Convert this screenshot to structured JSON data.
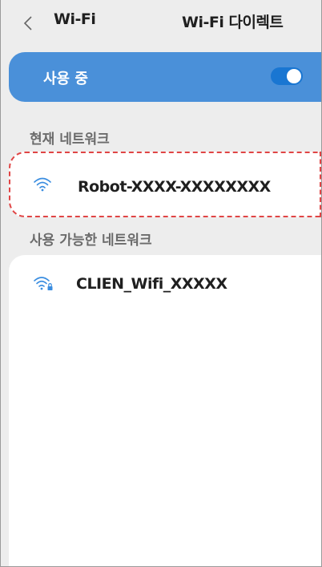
{
  "header": {
    "title": "Wi-Fi",
    "direct_label": "Wi-Fi 다이렉트"
  },
  "toggle": {
    "label": "사용 중",
    "state": "on"
  },
  "current_section": {
    "title": "현재 네트워크",
    "network": {
      "name": "Robot-XXXX-XXXXXXXX",
      "icon": "wifi-icon"
    }
  },
  "available_section": {
    "title": "사용 가능한 네트워크",
    "networks": [
      {
        "name": "CLIEN_Wifi_XXXXX",
        "icon": "wifi-lock-icon"
      }
    ]
  },
  "colors": {
    "accent": "#4a90d9",
    "switch": "#1976d2",
    "highlight_border": "#e04545",
    "background": "#ededed"
  }
}
